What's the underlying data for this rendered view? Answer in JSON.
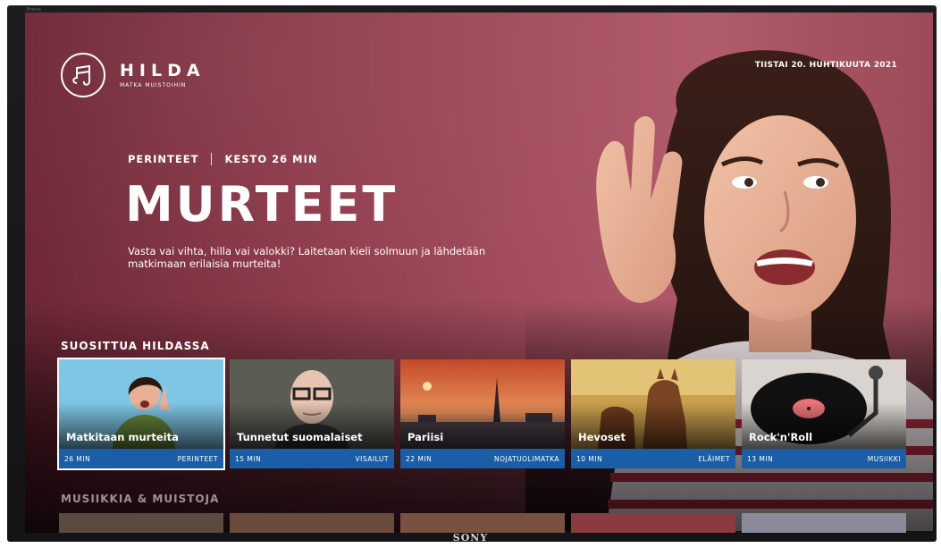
{
  "tv": {
    "brand": "SONY",
    "bezel_label": "Bravia"
  },
  "app": {
    "name": "HILDA",
    "tagline": "MATKA MUISTOIHIN"
  },
  "date": "TIISTAI 20. HUHTIKUUTA 2021",
  "hero": {
    "category": "PERINTEET",
    "duration": "KESTO 26 MIN",
    "title": "MURTEET",
    "description": "Vasta vai vihta, hilla vai valokki? Laitetaan kieli solmuun ja lähdetään matkimaan erilaisia murteita!"
  },
  "sections": [
    {
      "title": "SUOSITTUA HILDASSA",
      "cards": [
        {
          "title": "Matkitaan murteita",
          "duration": "26 MIN",
          "category": "PERINTEET",
          "focused": true
        },
        {
          "title": "Tunnetut suomalaiset",
          "duration": "15 MIN",
          "category": "VISAILUT"
        },
        {
          "title": "Pariisi",
          "duration": "22 MIN",
          "category": "NOJATUOLIMATKA"
        },
        {
          "title": "Hevoset",
          "duration": "10 MIN",
          "category": "ELÄIMET"
        },
        {
          "title": "Rock'n'Roll",
          "duration": "13 MIN",
          "category": "MUSIIKKI"
        }
      ]
    },
    {
      "title": "MUSIIKKIA & MUISTOJA"
    }
  ],
  "colors": {
    "accent_bar": "#1a5ea8",
    "background": "#a2495a"
  }
}
